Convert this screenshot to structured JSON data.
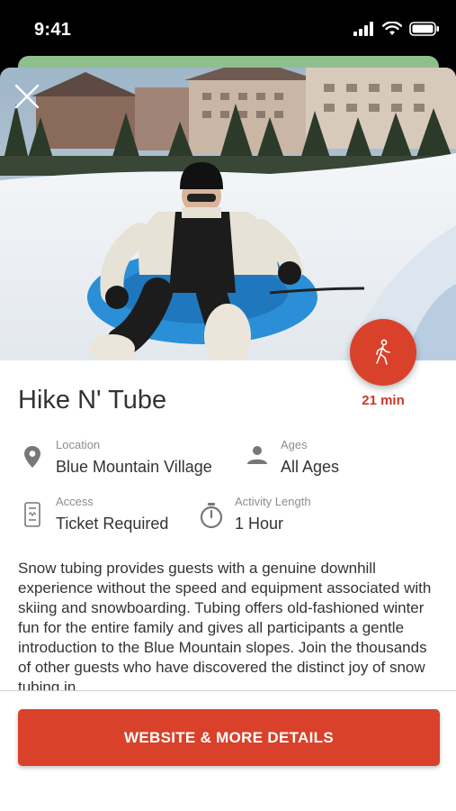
{
  "status_bar": {
    "time": "9:41",
    "icons": [
      "cellular-signal-icon",
      "wifi-icon",
      "battery-icon"
    ]
  },
  "hero": {
    "image": "snow-tubing-photo",
    "close_icon": "close-icon"
  },
  "walk": {
    "icon": "walking-person-icon",
    "time": "21 min"
  },
  "title": "Hike N' Tube",
  "details": {
    "location": {
      "label": "Location",
      "value": "Blue Mountain Village",
      "icon": "location-pin-icon"
    },
    "ages": {
      "label": "Ages",
      "value": "All Ages",
      "icon": "person-icon"
    },
    "access": {
      "label": "Access",
      "value": "Ticket Required",
      "icon": "ticket-icon"
    },
    "length": {
      "label": "Activity Length",
      "value": "1 Hour",
      "icon": "stopwatch-icon"
    }
  },
  "description": "Snow tubing provides guests with a genuine downhill experience without the speed and equipment associated with skiing and snowboarding. Tubing offers old-fashioned winter fun for the entire family and gives all participants a gentle introduction to the Blue Mountain slopes. Join the thousands of other guests who have discovered the distinct joy of snow tubing in",
  "cta": {
    "label": "WEBSITE & MORE DETAILS"
  },
  "colors": {
    "accent": "#d9412a",
    "text": "#333333",
    "muted": "#8e8e8e"
  }
}
